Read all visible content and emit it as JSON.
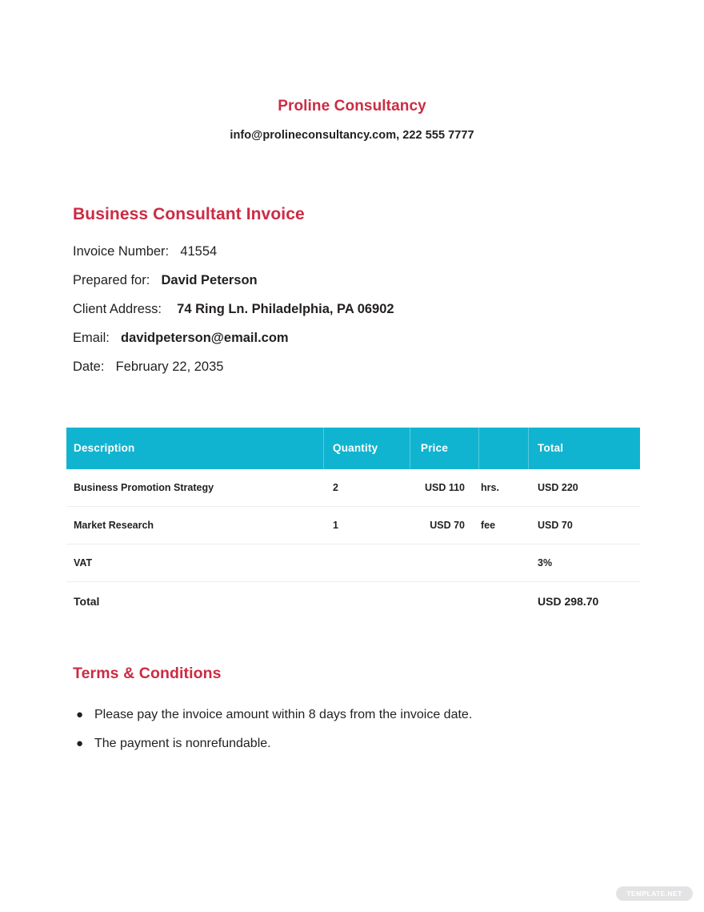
{
  "letterhead": {
    "company_name": "Proline Consultancy",
    "contact": "info@prolineconsultancy.com, 222 555 7777"
  },
  "invoice": {
    "title": "Business Consultant Invoice",
    "invoice_number_label": "Invoice Number:",
    "invoice_number_value": "41554",
    "prepared_for_label": "Prepared for:",
    "prepared_for_value": "David Peterson",
    "client_address_label": "Client Address:",
    "client_address_value": "74 Ring Ln. Philadelphia, PA 06902",
    "email_label": "Email:",
    "email_value": "davidpeterson@email.com",
    "date_label": "Date:",
    "date_value": "February 22, 2035"
  },
  "table": {
    "headers": {
      "description": "Description",
      "quantity": "Quantity",
      "price": "Price",
      "unit": "",
      "total": "Total"
    },
    "rows": [
      {
        "description": "Business Promotion Strategy",
        "quantity": "2",
        "price": "USD 110",
        "unit": "hrs.",
        "total": "USD 220"
      },
      {
        "description": "Market Research",
        "quantity": "1",
        "price": "USD 70",
        "unit": "fee",
        "total": "USD 70"
      },
      {
        "description": "VAT",
        "quantity": "",
        "price": "",
        "unit": "",
        "total": "3%"
      }
    ],
    "total_row": {
      "label": "Total",
      "amount": "USD 298.70"
    }
  },
  "terms": {
    "title": "Terms & Conditions",
    "bullet_glyph": "●",
    "items": [
      "Please pay the invoice amount within 8 days from the invoice date.",
      "The payment is nonrefundable."
    ]
  },
  "watermark": {
    "text": "TEMPLATE.NET"
  },
  "colors": {
    "brand_red": "#cc2b43",
    "table_header_teal": "#11b4d0",
    "row_divider": "#ededf0",
    "text": "#231f20"
  }
}
